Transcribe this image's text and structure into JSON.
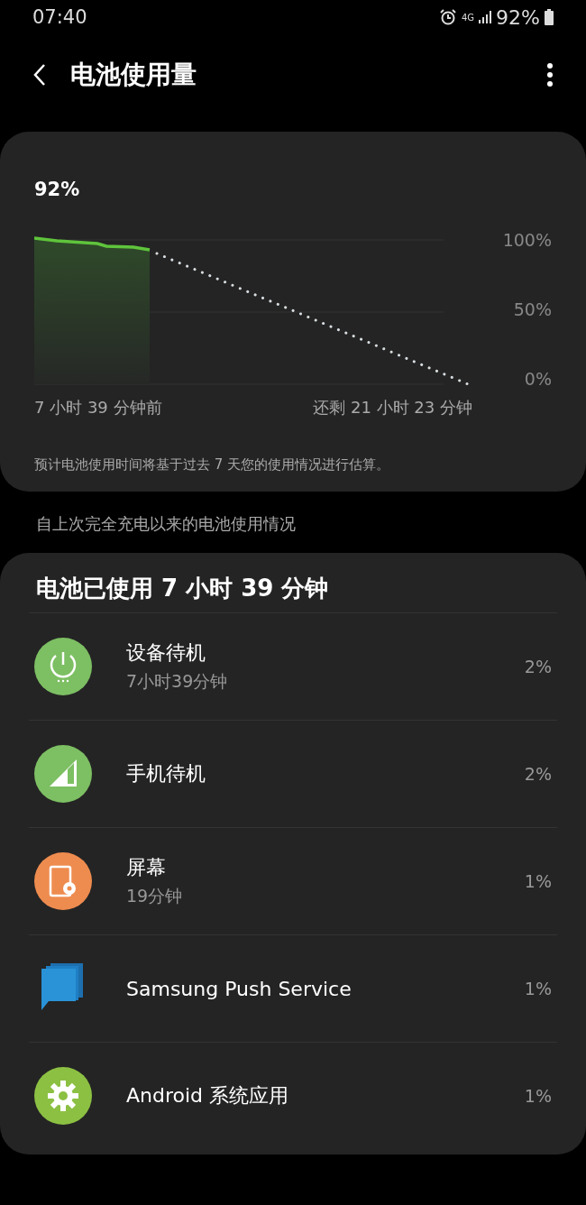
{
  "status_bar": {
    "time": "07:40",
    "network": "4G",
    "battery": "92%"
  },
  "header": {
    "title": "电池使用量"
  },
  "chart_card": {
    "level_text": "92%",
    "yticks": [
      "100%",
      "50%",
      "0%"
    ],
    "start_label": "7 小时 39 分钟前",
    "end_label": "还剩 21 小时 23 分钟",
    "note": "预计电池使用时间将基于过去 7 天您的使用情况进行估算。"
  },
  "section_title": "自上次完全充电以来的电池使用情况",
  "usage_card": {
    "title": "电池已使用 7 小时 39 分钟",
    "items": [
      {
        "kind": "power",
        "name": "设备待机",
        "detail": "7小时39分钟",
        "percent": "2%",
        "color": "#7dbf63"
      },
      {
        "kind": "signal",
        "name": "手机待机",
        "percent": "2%",
        "color": "#7dbf63"
      },
      {
        "kind": "screen",
        "name": "屏幕",
        "detail": "19分钟",
        "percent": "1%",
        "color": "#ee8c4f"
      },
      {
        "kind": "push",
        "name": "Samsung Push Service",
        "percent": "1%"
      },
      {
        "kind": "gear",
        "name": "Android 系统应用",
        "percent": "1%",
        "color": "#8cc043"
      }
    ]
  }
}
